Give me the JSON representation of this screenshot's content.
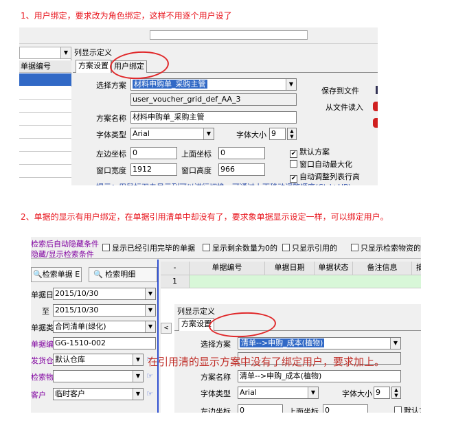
{
  "note1": "1、用户绑定，要求改为角色绑定，这样不用逐个用户设了",
  "note2": "2、单据的显示有用户绑定，在单据引用清单中却没有了，要求象单据显示设定一样，可以绑定用户。",
  "shot1": {
    "left_header": "单据编号",
    "window_title": "列显示定义",
    "tabs": [
      "方案设置",
      "用户绑定"
    ],
    "scheme_label": "选择方案",
    "scheme_value": "材料申购单_采购主管",
    "scheme_code": "user_voucher_grid_def_AA_3",
    "name_label": "方案名称",
    "name_value": "材料申购单_采购主管",
    "font_label": "字体类型",
    "font_value": "Arial",
    "size_label": "字体大小",
    "size_value": "9",
    "left_label": "左边坐标",
    "left_value": "0",
    "top_label": "上面坐标",
    "top_value": "0",
    "width_label": "窗口宽度",
    "width_value": "1912",
    "height_label": "窗口高度",
    "height_value": "966",
    "save_file": "保存到文件",
    "load_file": "从文件读入",
    "checks": [
      {
        "label": "默认方案",
        "checked": true
      },
      {
        "label": "窗口自动最大化",
        "checked": false
      },
      {
        "label": "自动调整列表行高",
        "checked": true
      }
    ],
    "hint": "提示：用鼠标双击显示列可以进行切换，可通过上下移动调整顺序(Ctrl+UP)"
  },
  "shot2": {
    "top_left_links": [
      "检索后自动隐藏条件",
      "隐藏/显示检索条件"
    ],
    "filters": [
      "显示已经引用完毕的单据",
      "显示剩余数量为0的",
      "只显示引用的",
      "只显示检索物资的明细"
    ],
    "search_buttons": [
      "检索单据 E",
      "检索明细"
    ],
    "side_labels": [
      "单据日期",
      "至",
      "单据类型",
      "单据编号",
      "发货仓库",
      "检索物资",
      "客户"
    ],
    "side_values": [
      "2015/10/30",
      "2015/10/30",
      "合同清单(绿化)",
      "GG-1510-002",
      "默认仓库",
      "",
      "临时客户"
    ],
    "grid_headers": [
      "-",
      "单据编号",
      "单据日期",
      "单据状态",
      "备注信息",
      "摘要"
    ],
    "grid_row": "1",
    "window_title": "列显示定义",
    "tabs": [
      "方案设置"
    ],
    "scheme_label": "选择方案",
    "scheme_value": "清单-->申购_成本(植物)",
    "name_label": "方案名称",
    "name_value": "清单-->申购_成本(植物)",
    "font_label": "字体类型",
    "font_value": "Arial",
    "size_label": "字体大小",
    "size_value": "9",
    "left_label": "左边坐标",
    "left_value": "0",
    "top_label": "上面坐标",
    "top_value": "0",
    "check_default": "默认方案",
    "overlay_note": "在引用清的显示方案中没有了绑定用户，要求加上。"
  }
}
